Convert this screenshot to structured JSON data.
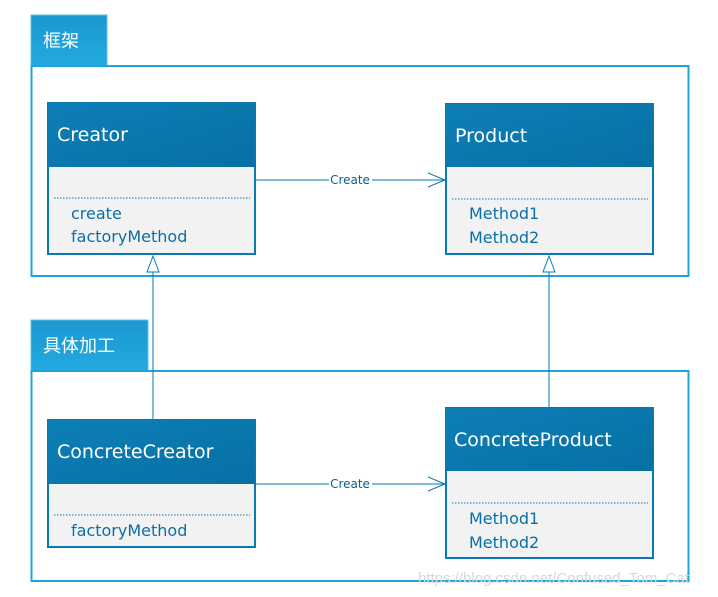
{
  "packages": [
    {
      "name": "框架"
    },
    {
      "name": "具体加工"
    }
  ],
  "classes": {
    "creator": {
      "name": "Creator",
      "methods": [
        "create",
        "factoryMethod"
      ]
    },
    "product": {
      "name": "Product",
      "methods": [
        "Method1",
        "Method2"
      ]
    },
    "concrete_creator": {
      "name": "ConcreteCreator",
      "methods": [
        "factoryMethod"
      ]
    },
    "concrete_product": {
      "name": "ConcreteProduct",
      "methods": [
        "Method1",
        "Method2"
      ]
    }
  },
  "relations": {
    "top_create": "Create",
    "bottom_create": "Create"
  },
  "colors": {
    "header": "#0a79b0",
    "tab": "#1fa3d8",
    "frame": "#1fa3d8",
    "body": "#f2f2f2"
  },
  "watermark": "https://blog.csdn.net/Confused_Tom_Cat"
}
